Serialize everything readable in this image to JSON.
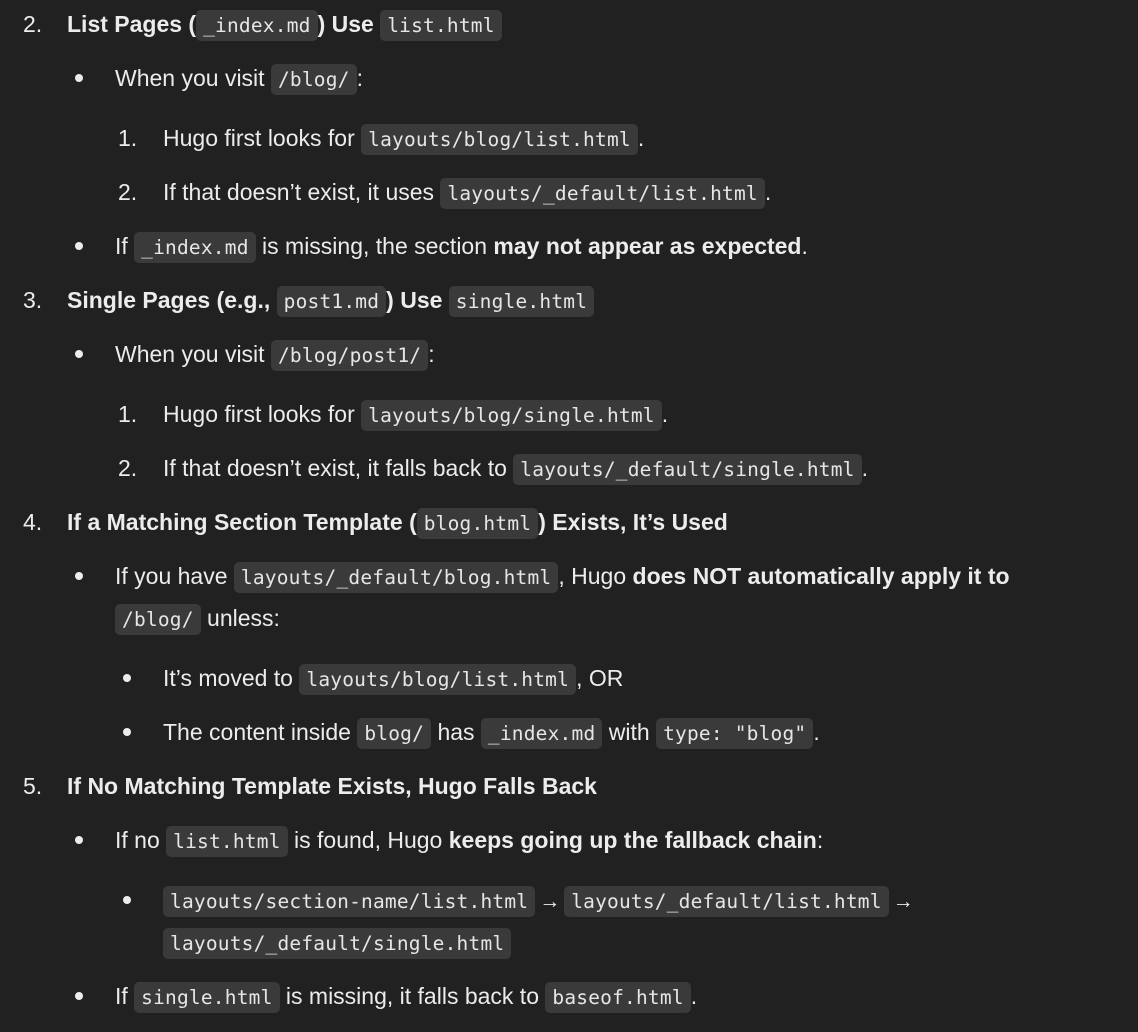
{
  "items": {
    "n2": {
      "number": "2.",
      "t1": "List Pages (",
      "c1": "_index.md",
      "t2": ") Use",
      "c2": "list.html"
    },
    "n2_b1": {
      "t1": "When you visit",
      "c1": "/blog/",
      "t2": ":"
    },
    "n2_b1_s1": {
      "number": "1.",
      "t1": "Hugo first looks for",
      "c1": "layouts/blog/list.html",
      "t2": "."
    },
    "n2_b1_s2": {
      "number": "2.",
      "t1": "If that doesn’t exist, it uses",
      "c1": "layouts/_default/list.html",
      "t2": "."
    },
    "n2_b2": {
      "t1": "If",
      "c1": "_index.md",
      "t2": "is missing, the section",
      "s1": "may not appear as expected",
      "t3": "."
    },
    "n3": {
      "number": "3.",
      "t1": "Single Pages (e.g.,",
      "c1": "post1.md",
      "t2": ") Use",
      "c2": "single.html"
    },
    "n3_b1": {
      "t1": "When you visit",
      "c1": "/blog/post1/",
      "t2": ":"
    },
    "n3_b1_s1": {
      "number": "1.",
      "t1": "Hugo first looks for",
      "c1": "layouts/blog/single.html",
      "t2": "."
    },
    "n3_b1_s2": {
      "number": "2.",
      "t1": "If that doesn’t exist, it falls back to",
      "c1": "layouts/_default/single.html",
      "t2": "."
    },
    "n4": {
      "number": "4.",
      "t1": "If a Matching Section Template (",
      "c1": "blog.html",
      "t2": ") Exists, It’s Used"
    },
    "n4_b1": {
      "t1": "If you have",
      "c1": "layouts/_default/blog.html",
      "t2": ", Hugo",
      "s1": "does NOT automatically apply it to",
      "c2": "/blog/",
      "t3": "unless:"
    },
    "n4_b1_s1": {
      "t1": "It’s moved to",
      "c1": "layouts/blog/list.html",
      "t2": ", OR"
    },
    "n4_b1_s2": {
      "t1": "The content inside",
      "c1": "blog/",
      "t2": "has",
      "c2": "_index.md",
      "t3": "with",
      "c3": "type: \"blog\"",
      "t4": "."
    },
    "n5": {
      "number": "5.",
      "t1": "If No Matching Template Exists, Hugo Falls Back"
    },
    "n5_b1": {
      "t1": "If no",
      "c1": "list.html",
      "t2": "is found, Hugo",
      "s1": "keeps going up the fallback chain",
      "t3": ":"
    },
    "n5_b1_s1": {
      "c1": "layouts/section-name/list.html",
      "arrow1": "→",
      "c2": "layouts/_default/list.html",
      "arrow2": "→",
      "c3": "layouts/_default/single.html"
    },
    "n5_b2": {
      "t1": "If",
      "c1": "single.html",
      "t2": "is missing, it falls back to",
      "c2": "baseof.html",
      "t3": "."
    }
  }
}
